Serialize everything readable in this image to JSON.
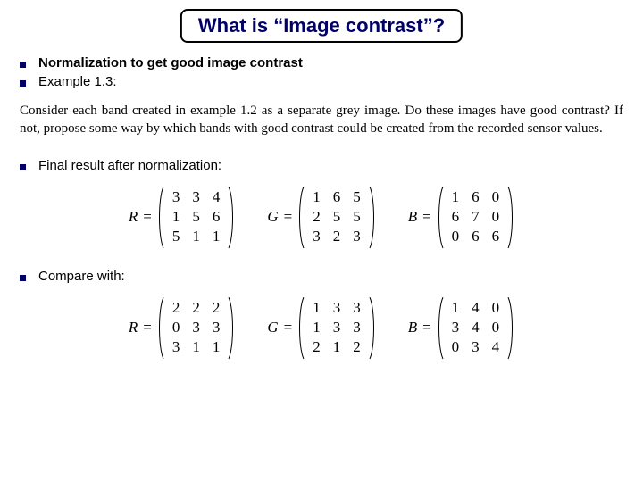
{
  "title": "What is “Image contrast”?",
  "bullets": {
    "b1": "Normalization to get good image contrast",
    "b2": "Example 1.3:",
    "b3": "Final result after normalization:",
    "b4": "Compare with:"
  },
  "problem": "Consider each band created in example 1.2 as a separate grey image. Do these images have good contrast? If not, propose some way by which bands with good contrast could be created from the recorded sensor values.",
  "matrices_after": {
    "R": [
      [
        3,
        3,
        4
      ],
      [
        1,
        5,
        6
      ],
      [
        5,
        1,
        1
      ]
    ],
    "G": [
      [
        1,
        6,
        5
      ],
      [
        2,
        5,
        5
      ],
      [
        3,
        2,
        3
      ]
    ],
    "B": [
      [
        1,
        6,
        0
      ],
      [
        6,
        7,
        0
      ],
      [
        0,
        6,
        6
      ]
    ]
  },
  "matrices_before": {
    "R": [
      [
        2,
        2,
        2
      ],
      [
        0,
        3,
        3
      ],
      [
        3,
        1,
        1
      ]
    ],
    "G": [
      [
        1,
        3,
        3
      ],
      [
        1,
        3,
        3
      ],
      [
        2,
        1,
        2
      ]
    ],
    "B": [
      [
        1,
        4,
        0
      ],
      [
        3,
        4,
        0
      ],
      [
        0,
        3,
        4
      ]
    ]
  },
  "labels": {
    "R": "R",
    "G": "G",
    "B": "B",
    "eq": "="
  }
}
